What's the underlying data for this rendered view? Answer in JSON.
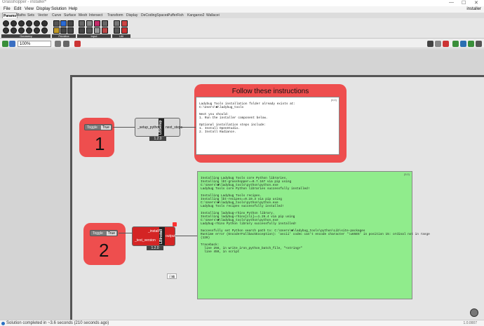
{
  "window": {
    "title": "Grasshopper - installer*",
    "user": "installer",
    "min": "—",
    "max": "☐",
    "close": "✕"
  },
  "menu": [
    "File",
    "Edit",
    "View",
    "Display",
    "Solution",
    "Help"
  ],
  "tabs": [
    "Params",
    "Maths",
    "Sets",
    "Vector",
    "Curve",
    "Surface",
    "Mesh",
    "Intersect",
    "Transform",
    "Display",
    "DeCodingSpaces",
    "PufferFish",
    "Kangaroo2",
    "Wallacei"
  ],
  "ribbon_groups": [
    "Geometry",
    "Primitive",
    "Input",
    "Util"
  ],
  "toolbar": {
    "zoom": "100%"
  },
  "annotations": {
    "step1": "1",
    "step2": "2",
    "heading": "Follow these instructions"
  },
  "toggle1": {
    "label": "Toggle",
    "value": "True"
  },
  "toggle2": {
    "label": "Toggle",
    "value": "True"
  },
  "setup_component": {
    "input": "_setup_python",
    "output": "next_steps",
    "name": "LBSetup",
    "version": "1.2.0"
  },
  "install_component": {
    "inputs": [
      "_install",
      "_test_version"
    ],
    "output": "output",
    "name": "LBInstall",
    "version": "1.2.0"
  },
  "panel1": {
    "corner": "(0;0)",
    "lines": [
      "Ladybug Tools installation folder already exists at:",
      "C:\\Users\\■\\ladybug_tools",
      "",
      "Next you should:",
      "1. Run the installer component below.",
      "",
      "Optional installation steps include:",
      "1. Install OpenStudio.",
      "2. Install Radiance."
    ]
  },
  "panel2": {
    "corner": "(0;0)",
    "lines": [
      "Installing Ladybug Tools core Python libraries.",
      "Installing lbt-grasshopper==0.7.167 via pip using",
      "C:\\Users\\■\\ladybug_tools\\python\\python.exe",
      "Ladybug Tools core Python libraries successfully installed!",
      "",
      "Installing Ladybug Tools recipes.",
      "Installing lbt-recipes==0.19.3 via pip using",
      "C:\\Users\\■\\ladybug_tools\\python\\python.exe",
      "Ladybug Tools recipes successfully installed!",
      "",
      "Installing ladybug-rhino Python library.",
      "Installing ladybug-rhino[cli]==1.26.4 via pip using",
      "C:\\Users\\■\\ladybug_tools\\python\\python.exe",
      "Ladybug-rhino Python library successfully installed!",
      "",
      "Successfully set Python search path to: C:\\Users\\■\\ladybug_tools\\python\\Lib\\site-packages",
      "Runtime error (EncoderFallbackException): 'ascii' codec can't encode character '\\u65E5' in position 15: ordinal not in range",
      "(128)",
      "",
      "Traceback:",
      "  line 256, in write_iron_python_batch_file, \"<string>\"",
      "  line 459, in script"
    ]
  },
  "smallbox": "已编",
  "status": {
    "text": "Solution completed in ~3.6 seconds (210 seconds ago)",
    "version": "1.0.0007"
  },
  "colors": {
    "red": "#ee4e4e",
    "green": "#90ec8c",
    "panel_white": "#ffffff"
  }
}
